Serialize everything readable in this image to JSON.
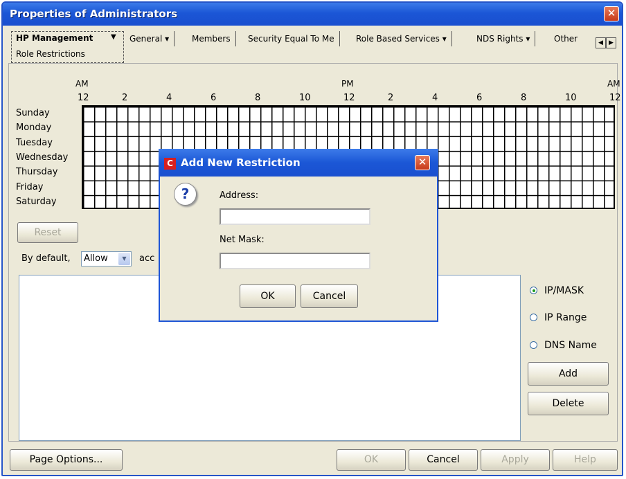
{
  "window": {
    "title": "Properties of Administrators"
  },
  "tabs": {
    "active": {
      "label": "HP Management",
      "sublabel": "Role Restrictions"
    },
    "items": [
      {
        "label": "General ▾"
      },
      {
        "label": "Members"
      },
      {
        "label": "Security Equal To Me"
      },
      {
        "label": "Role Based Services ▾"
      },
      {
        "label": "NDS Rights ▾"
      },
      {
        "label": "Other"
      }
    ]
  },
  "schedule": {
    "am_label": "AM",
    "pm_label": "PM",
    "am_label_end": "AM",
    "hours": [
      "12",
      "2",
      "4",
      "6",
      "8",
      "10",
      "12",
      "2",
      "4",
      "6",
      "8",
      "10",
      "12"
    ],
    "days": [
      "Sunday",
      "Monday",
      "Tuesday",
      "Wednesday",
      "Thursday",
      "Friday",
      "Saturday"
    ]
  },
  "reset_label": "Reset",
  "default_text": "By default,",
  "default_value": "Allow",
  "access_text": "acc",
  "radios": {
    "ip_mask": "IP/MASK",
    "ip_range": "IP Range",
    "dns_name": "DNS Name"
  },
  "add_label": "Add",
  "delete_label": "Delete",
  "bottom": {
    "page_options": "Page Options...",
    "ok": "OK",
    "cancel": "Cancel",
    "apply": "Apply",
    "help": "Help"
  },
  "dialog": {
    "title": "Add New Restriction",
    "address_label": "Address:",
    "netmask_label": "Net Mask:",
    "address_value": "",
    "netmask_value": "",
    "ok": "OK",
    "cancel": "Cancel"
  }
}
